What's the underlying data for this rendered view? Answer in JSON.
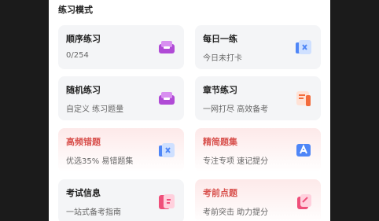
{
  "section": {
    "title": "练习模式"
  },
  "cards": [
    {
      "title": "顺序练习",
      "subtitle": "0/254",
      "icon": "purple-box-icon"
    },
    {
      "title": "每日一练",
      "subtitle": "今日未打卡",
      "icon": "calendar-icon"
    },
    {
      "title": "随机练习",
      "subtitle": "自定义 练习题量",
      "icon": "purple-box-icon"
    },
    {
      "title": "章节练习",
      "subtitle": "一网打尽 高效备考",
      "icon": "document-icon"
    },
    {
      "title": "高频错题",
      "subtitle": "优选35% 易错题集",
      "icon": "error-book-icon"
    },
    {
      "title": "精简题集",
      "subtitle": "专注专项 速记提分",
      "icon": "letter-a-icon"
    },
    {
      "title": "考试信息",
      "subtitle": "一站式备考指南",
      "icon": "info-card-icon"
    },
    {
      "title": "考前点题",
      "subtitle": "考前突击 助力提分",
      "icon": "edit-note-icon"
    }
  ],
  "colors": {
    "accent_red": "#d9534f",
    "purple": "#b04ad6",
    "blue": "#4f86f7",
    "orange": "#f36b3b",
    "pink": "#ef4f7a"
  }
}
